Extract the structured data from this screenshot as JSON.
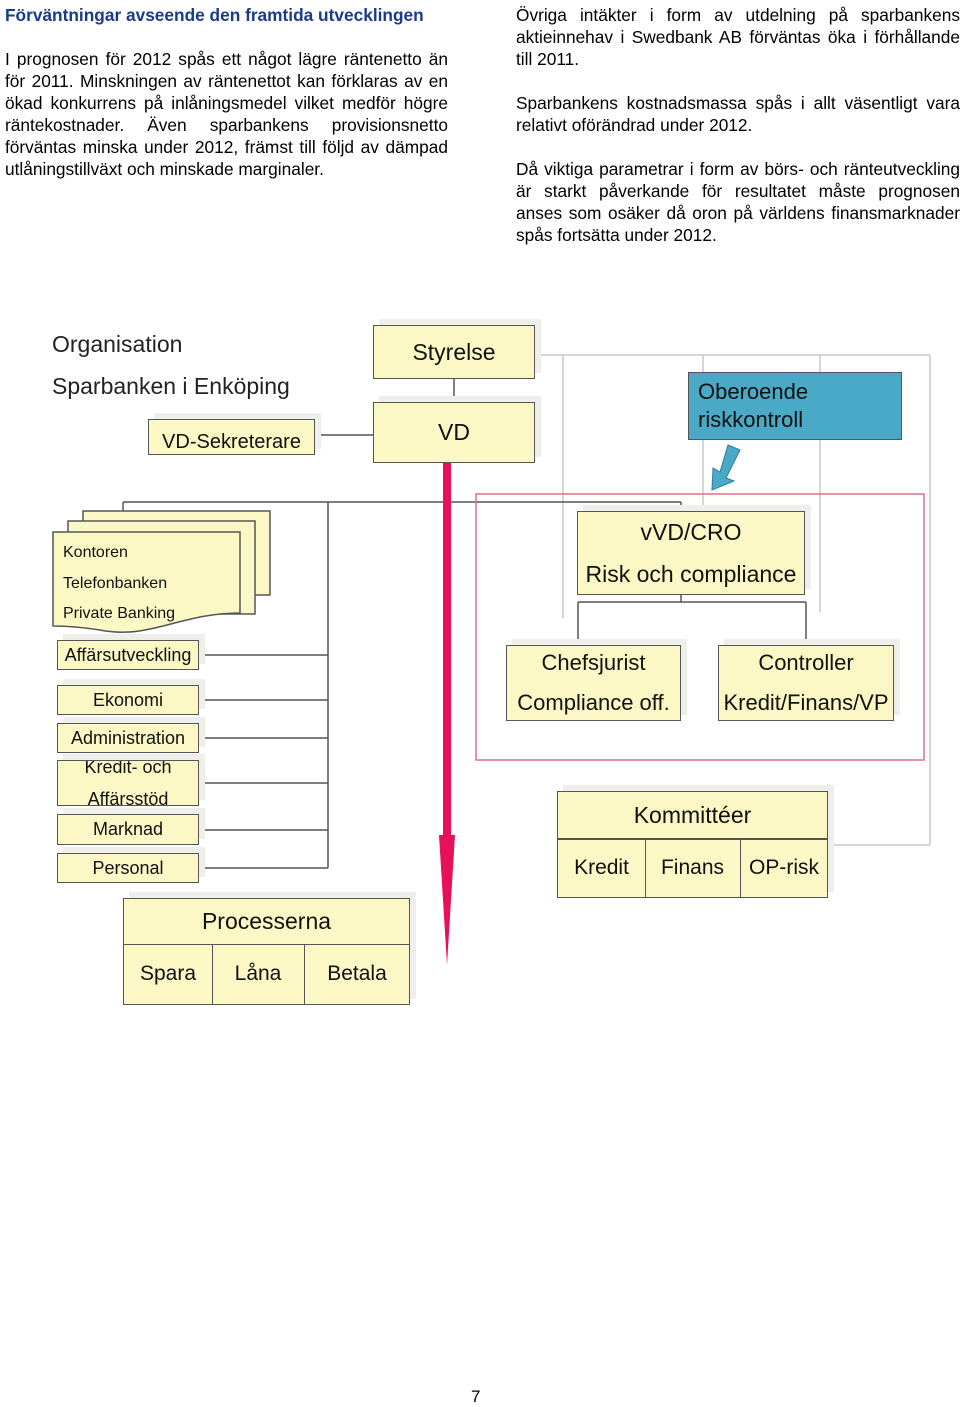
{
  "left_column": {
    "heading": "Förväntningar avseende den framtida utvecklingen",
    "paragraphs": [
      "I prognosen för 2012 spås ett något lägre räntenetto än för 2011. Minskningen av räntenettot kan förklaras av en ökad konkurrens på inlåningsmedel vilket medför högre räntekostnader. Även sparbankens provisionsnetto förväntas minska under 2012, främst till följd av dämpad utlåningstillväxt och minskade marginaler."
    ]
  },
  "right_column": {
    "paragraphs": [
      "Övriga intäkter i form av utdelning på sparbankens aktieinnehav i Swedbank AB förväntas öka i förhållande till 2011.",
      "Sparbankens kostnadsmassa spås i allt väsentligt vara relativt oförändrad under 2012.",
      "Då viktiga parametrar i form av börs- och ränteutveckling är starkt påverkande för resultatet måste prognosen anses som osäker då oron på världens finansmarknader spås fortsätta under 2012."
    ]
  },
  "org_chart": {
    "title": "Organisation",
    "subtitle": "Sparbanken i Enköping",
    "styrelse": "Styrelse",
    "vd": "VD",
    "vd_sekreterare": "VD-Sekreterare",
    "oberoende": [
      "Oberoende",
      "riskkontroll"
    ],
    "branches": [
      "Kontoren",
      "Telefonbanken",
      "Private Banking"
    ],
    "departments": [
      "Affärsutveckling",
      "Ekonomi",
      "Administration",
      "Kredit- och",
      "Affärsstöd",
      "Marknad",
      "Personal"
    ],
    "processes": {
      "title": "Processerna",
      "items": [
        "Spara",
        "Låna",
        "Betala"
      ]
    },
    "vvd": [
      "vVD/CRO",
      "Risk och compliance"
    ],
    "chefsjurist": [
      "Chefsjurist",
      "Compliance off."
    ],
    "controller": [
      "Controller",
      "Kredit/Finans/VP"
    ],
    "committees": {
      "title": "Kommittéer",
      "items": [
        "Kredit",
        "Finans",
        "OP-risk"
      ]
    },
    "colors": {
      "box_fill": "#fbf8c6",
      "risk_box": "#4aa9c6",
      "arrow": "#e8105a",
      "risk_frame": "#e07080"
    }
  },
  "page_number": "7"
}
